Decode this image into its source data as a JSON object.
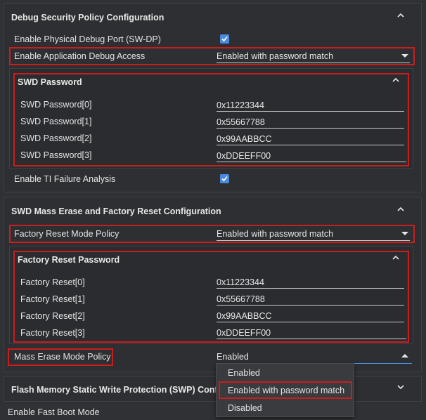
{
  "debug_section": {
    "title": "Debug Security Policy Configuration",
    "physical_port_label": "Enable Physical Debug Port (SW-DP)",
    "physical_port_checked": true,
    "app_debug_label": "Enable Application Debug Access",
    "app_debug_value": "Enabled with password match",
    "ti_failure_label": "Enable TI Failure Analysis",
    "ti_failure_checked": true
  },
  "swd_password": {
    "title": "SWD Password",
    "rows": [
      {
        "label": "SWD Password[0]",
        "value": "0x11223344"
      },
      {
        "label": "SWD Password[1]",
        "value": "0x55667788"
      },
      {
        "label": "SWD Password[2]",
        "value": "0x99AABBCC"
      },
      {
        "label": "SWD Password[3]",
        "value": "0xDDEEFF00"
      }
    ]
  },
  "mass_erase_section": {
    "title": "SWD Mass Erase and Factory Reset Configuration",
    "factory_reset_label": "Factory Reset Mode Policy",
    "factory_reset_value": "Enabled with password match",
    "mass_erase_label": "Mass Erase Mode Policy",
    "mass_erase_value": "Enabled"
  },
  "factory_reset_password": {
    "title": "Factory Reset Password",
    "rows": [
      {
        "label": "Factory Reset[0]",
        "value": "0x11223344"
      },
      {
        "label": "Factory Reset[1]",
        "value": "0x55667788"
      },
      {
        "label": "Factory Reset[2]",
        "value": "0x99AABBCC"
      },
      {
        "label": "Factory Reset[3]",
        "value": "0xDDEEFF00"
      }
    ]
  },
  "dropdown": {
    "options": [
      "Enabled",
      "Enabled with password match",
      "Disabled"
    ],
    "highlighted_index": 1
  },
  "swp_section": {
    "title": "Flash Memory Static Write Protection (SWP) Configura"
  },
  "fast_boot": {
    "label": "Enable Fast Boot Mode"
  },
  "colors": {
    "background": "#303134",
    "highlight": "#c81e1e",
    "checkbox": "#4a8be0",
    "focus_underline": "#4a90e2"
  }
}
